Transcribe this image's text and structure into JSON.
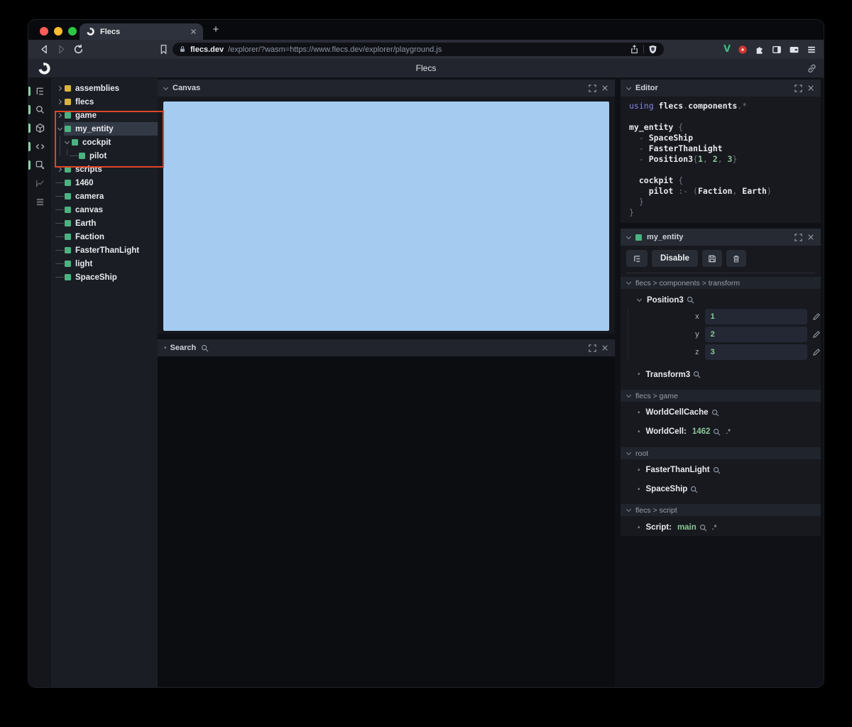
{
  "browser": {
    "tab": {
      "title": "Flecs"
    },
    "address": {
      "host": "flecs.dev",
      "path": "/explorer/?wasm=https://www.flecs.dev/explorer/playground.js"
    }
  },
  "app": {
    "title": "Flecs"
  },
  "nav_icons": [
    {
      "name": "hierarchy-icon",
      "active": true
    },
    {
      "name": "search-icon",
      "active": true
    },
    {
      "name": "cube-icon",
      "active": true
    },
    {
      "name": "code-icon",
      "active": true
    },
    {
      "name": "inspect-icon",
      "active": true
    },
    {
      "name": "chart-icon",
      "active": false
    },
    {
      "name": "logs-icon",
      "active": false
    }
  ],
  "tree": {
    "items": [
      {
        "label": "assemblies",
        "color": "yellow",
        "state": "collapsed",
        "depth": 0,
        "selected": false
      },
      {
        "label": "flecs",
        "color": "yellow",
        "state": "collapsed",
        "depth": 0,
        "selected": false
      },
      {
        "label": "game",
        "color": "green",
        "state": "collapsed",
        "depth": 0,
        "selected": false
      },
      {
        "label": "my_entity",
        "color": "green",
        "state": "expanded",
        "depth": 0,
        "selected": true
      },
      {
        "label": "cockpit",
        "color": "green",
        "state": "expanded",
        "depth": 1,
        "selected": false
      },
      {
        "label": "pilot",
        "color": "green",
        "state": "leaf",
        "depth": 2,
        "selected": false
      },
      {
        "label": "scripts",
        "color": "green",
        "state": "collapsed",
        "depth": 0,
        "selected": false
      },
      {
        "label": "1460",
        "color": "green",
        "state": "leaf",
        "depth": 0,
        "selected": false
      },
      {
        "label": "camera",
        "color": "green",
        "state": "leaf",
        "depth": 0,
        "selected": false
      },
      {
        "label": "canvas",
        "color": "green",
        "state": "leaf",
        "depth": 0,
        "selected": false
      },
      {
        "label": "Earth",
        "color": "green",
        "state": "leaf",
        "depth": 0,
        "selected": false
      },
      {
        "label": "Faction",
        "color": "green",
        "state": "leaf",
        "depth": 0,
        "selected": false
      },
      {
        "label": "FasterThanLight",
        "color": "green",
        "state": "leaf",
        "depth": 0,
        "selected": false
      },
      {
        "label": "light",
        "color": "green",
        "state": "leaf",
        "depth": 0,
        "selected": false
      },
      {
        "label": "SpaceShip",
        "color": "green",
        "state": "leaf",
        "depth": 0,
        "selected": false
      }
    ]
  },
  "annotation": {
    "type": "highlight-box",
    "color": "#de4527"
  },
  "canvas_panel": {
    "title": "Canvas"
  },
  "search_panel": {
    "title": "Search",
    "bullet": "•"
  },
  "editor": {
    "title": "Editor",
    "code": [
      [
        "using ",
        "flecs",
        ".",
        "components",
        ".*"
      ],
      [
        ""
      ],
      [
        "my_entity ",
        "{"
      ],
      [
        "  - ",
        "SpaceShip"
      ],
      [
        "  - ",
        "FasterThanLight"
      ],
      [
        "  - ",
        "Position3",
        "{",
        "1",
        ", ",
        "2",
        ", ",
        "3",
        "}"
      ],
      [
        ""
      ],
      [
        "  ",
        "cockpit ",
        "{"
      ],
      [
        "    ",
        "pilot ",
        ":- (",
        "Faction",
        ", ",
        "Earth",
        ")"
      ],
      [
        "  ",
        "}"
      ],
      [
        "}"
      ]
    ]
  },
  "inspector": {
    "title": "my_entity",
    "toolbar": {
      "disable": "Disable"
    },
    "pair_suffix": ".*",
    "sections": [
      {
        "path": "flecs > components > transform",
        "components": [
          {
            "name": "Position3",
            "fields": [
              {
                "label": "x",
                "value": "1"
              },
              {
                "label": "y",
                "value": "2"
              },
              {
                "label": "z",
                "value": "3"
              }
            ]
          },
          {
            "name": "Transform3"
          }
        ]
      },
      {
        "path": "flecs > game",
        "components": [
          {
            "name": "WorldCellCache"
          },
          {
            "name": "WorldCell:",
            "value": "1462"
          }
        ]
      },
      {
        "path": "root",
        "components": [
          {
            "name": "FasterThanLight"
          },
          {
            "name": "SpaceShip"
          }
        ]
      },
      {
        "path": "flecs > script",
        "components": [
          {
            "name": "Script:",
            "value": "main"
          }
        ]
      }
    ]
  },
  "colors": {
    "accent_green": "#4cb280",
    "accent_yellow": "#d9b33c",
    "annotation_red": "#de4527",
    "canvas_blue": "#a5cbf0",
    "code_green": "#8ac795",
    "code_purple": "#8583ea"
  }
}
